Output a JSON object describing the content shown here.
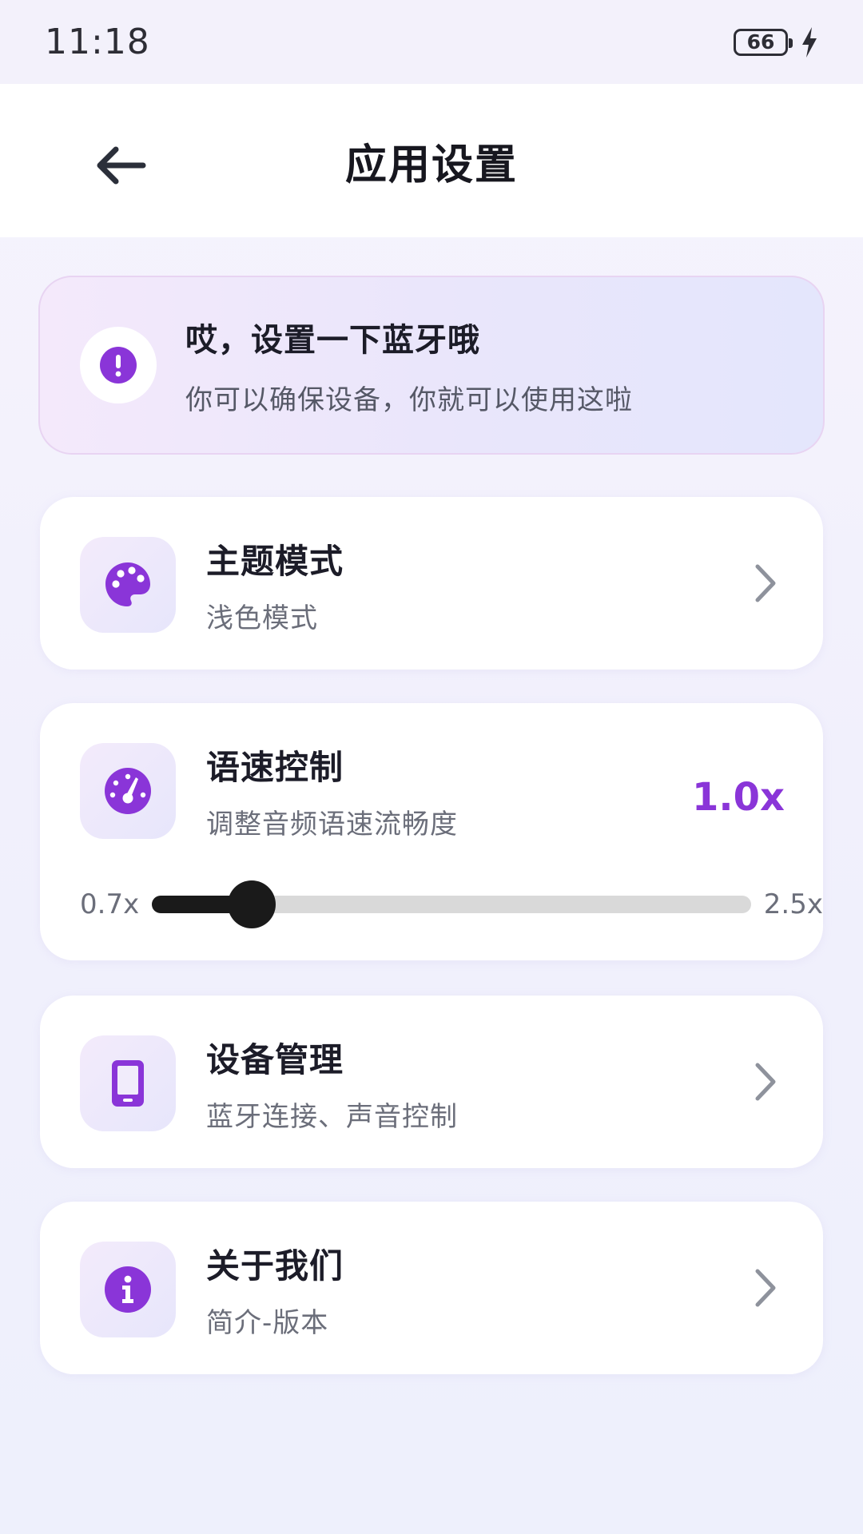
{
  "status_bar": {
    "time": "11:18",
    "battery": "66"
  },
  "header": {
    "title": "应用设置"
  },
  "alert": {
    "title": "哎，设置一下蓝牙哦",
    "description": "你可以确保设备，你就可以使用这啦"
  },
  "settings": {
    "theme": {
      "title": "主题模式",
      "subtitle": "浅色模式",
      "icon": "palette-icon"
    },
    "speed": {
      "title": "语速控制",
      "subtitle": "调整音频语速流畅度",
      "value_label": "1.0x",
      "min_label": "0.7x",
      "max_label": "2.5x",
      "min": 0.7,
      "max": 2.5,
      "value": 1.0,
      "icon": "speedometer-icon"
    },
    "device": {
      "title": "设备管理",
      "subtitle": "蓝牙连接、声音控制",
      "icon": "phone-icon"
    },
    "about": {
      "title": "关于我们",
      "subtitle": "简介-版本",
      "icon": "info-icon"
    }
  },
  "colors": {
    "accent": "#8a35d8",
    "slider_fill": "#1a1a1a",
    "slider_track": "#d9d9d9"
  }
}
